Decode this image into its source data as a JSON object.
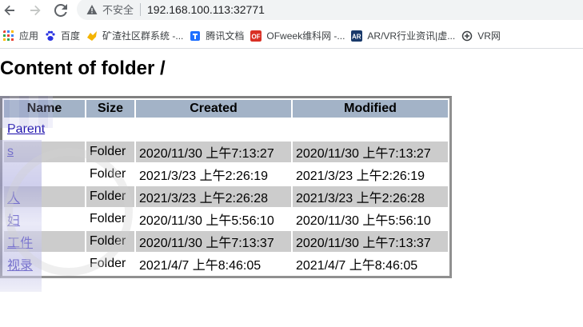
{
  "browser": {
    "security_label": "不安全",
    "url": "192.168.100.113:32771"
  },
  "bookmarks": [
    {
      "label": "应用",
      "icon": "apps-grid-icon",
      "color": "#4285f4"
    },
    {
      "label": "百度",
      "icon": "baidu-paw-icon",
      "color": "#2932e1"
    },
    {
      "label": "矿渣社区群系统 -...",
      "icon": "community-icon",
      "color": "#f4b400"
    },
    {
      "label": "腾讯文档",
      "icon": "tencent-docs-icon",
      "color": "#1e6fff"
    },
    {
      "label": "OFweek维科网 -...",
      "icon": "ofweek-icon",
      "color": "#d93025"
    },
    {
      "label": "AR/VR行业资讯|虚...",
      "icon": "arvr-icon",
      "color": "#1a3a6b"
    },
    {
      "label": "VR网",
      "icon": "vr-headset-icon",
      "color": "#3c4043"
    }
  ],
  "page": {
    "title": "Content of folder /"
  },
  "table": {
    "headers": [
      "Name",
      "Size",
      "Created",
      "Modified"
    ],
    "rows": [
      {
        "name": "Parent",
        "size": "",
        "created": "",
        "modified": ""
      },
      {
        "name": "s",
        "size": "Folder",
        "created": "2020/11/30 上午7:13:27",
        "modified": "2020/11/30 上午7:13:27"
      },
      {
        "name": "",
        "size": "Folder",
        "created": "2021/3/23 上午2:26:19",
        "modified": "2021/3/23 上午2:26:19"
      },
      {
        "name": "人",
        "size": "Folder",
        "created": "2021/3/23 上午2:26:28",
        "modified": "2021/3/23 上午2:26:28"
      },
      {
        "name": "妇",
        "size": "Folder",
        "created": "2020/11/30 上午5:56:10",
        "modified": "2020/11/30 上午5:56:10"
      },
      {
        "name": "工件",
        "size": "Folder",
        "created": "2020/11/30 上午7:13:37",
        "modified": "2020/11/30 上午7:13:37"
      },
      {
        "name": "视录",
        "size": "Folder",
        "created": "2021/4/7 上午8:46:05",
        "modified": "2021/4/7 上午8:46:05"
      }
    ]
  },
  "colors": {
    "header_bg": "#a3b3c7",
    "shaded_row": "#cccccc",
    "link": "#1a0dab"
  }
}
